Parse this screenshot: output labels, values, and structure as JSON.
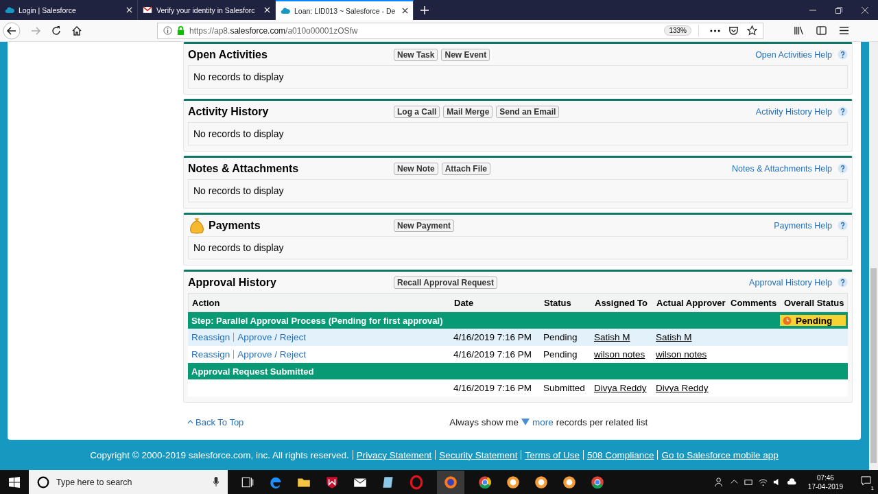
{
  "browser": {
    "tabs": [
      {
        "title": "Login | Salesforce",
        "kind": "cloud",
        "selected": false
      },
      {
        "title": "Verify your identity in Salesforc",
        "kind": "mail",
        "selected": false
      },
      {
        "title": "Loan: LID013 ~ Salesforce - De",
        "kind": "cloud",
        "selected": true
      }
    ],
    "url": {
      "prefix": "https://ap8.",
      "domain": "salesforce.com",
      "path": "/a010o00001zOSfw"
    },
    "zoom": "133%"
  },
  "sections": [
    {
      "title": "Open Activities",
      "kind": "plain",
      "buttons": [
        "New Task",
        "New Event"
      ],
      "help": "Open Activities Help",
      "empty": "No records to display"
    },
    {
      "title": "Activity History",
      "kind": "plain",
      "buttons": [
        "Log a Call",
        "Mail Merge",
        "Send an Email"
      ],
      "help": "Activity History Help",
      "empty": "No records to display"
    },
    {
      "title": "Notes & Attachments",
      "kind": "plain",
      "buttons": [
        "New Note",
        "Attach File"
      ],
      "help": "Notes & Attachments Help",
      "empty": "No records to display"
    },
    {
      "title": "Payments",
      "kind": "payment",
      "buttons": [
        "New Payment"
      ],
      "help": "Payments Help",
      "empty": "No records to display"
    }
  ],
  "approval": {
    "title": "Approval History",
    "button": "Recall Approval Request",
    "help": "Approval History Help",
    "columns": [
      "Action",
      "Date",
      "Status",
      "Assigned To",
      "Actual Approver",
      "Comments",
      "Overall Status"
    ],
    "rows": [
      {
        "kind": "step",
        "text": "Step: Parallel Approval Process (Pending for first approval)",
        "overall": "Pending"
      },
      {
        "kind": "item",
        "highlighted": true,
        "links": [
          "Reassign",
          "Approve / Reject"
        ],
        "date": "4/16/2019 7:16 PM",
        "status": "Pending",
        "assigned": "Satish M",
        "approver": "Satish M"
      },
      {
        "kind": "item",
        "highlighted": false,
        "links": [
          "Reassign",
          "Approve / Reject"
        ],
        "date": "4/16/2019 7:16 PM",
        "status": "Pending",
        "assigned": "wilson notes",
        "approver": "wilson notes"
      },
      {
        "kind": "step",
        "text": "Approval Request Submitted"
      },
      {
        "kind": "item",
        "highlighted": false,
        "links": [],
        "date": "4/16/2019 7:16 PM",
        "status": "Submitted",
        "assigned": "Divya Reddy",
        "approver": "Divya Reddy"
      }
    ]
  },
  "back_to_top": "Back To Top",
  "more": {
    "before": "Always show me",
    "link": "more",
    "after": "records per related list"
  },
  "footer": {
    "copyright": "Copyright © 2000-2019 salesforce.com, inc. All rights reserved.",
    "links": [
      "Privacy Statement",
      "Security Statement",
      "Terms of Use",
      "508 Compliance",
      "Go to Salesforce mobile app"
    ]
  },
  "taskbar": {
    "search": "Type here to search",
    "time": "07:46",
    "date": "17-04-2019",
    "notifications": "1"
  }
}
